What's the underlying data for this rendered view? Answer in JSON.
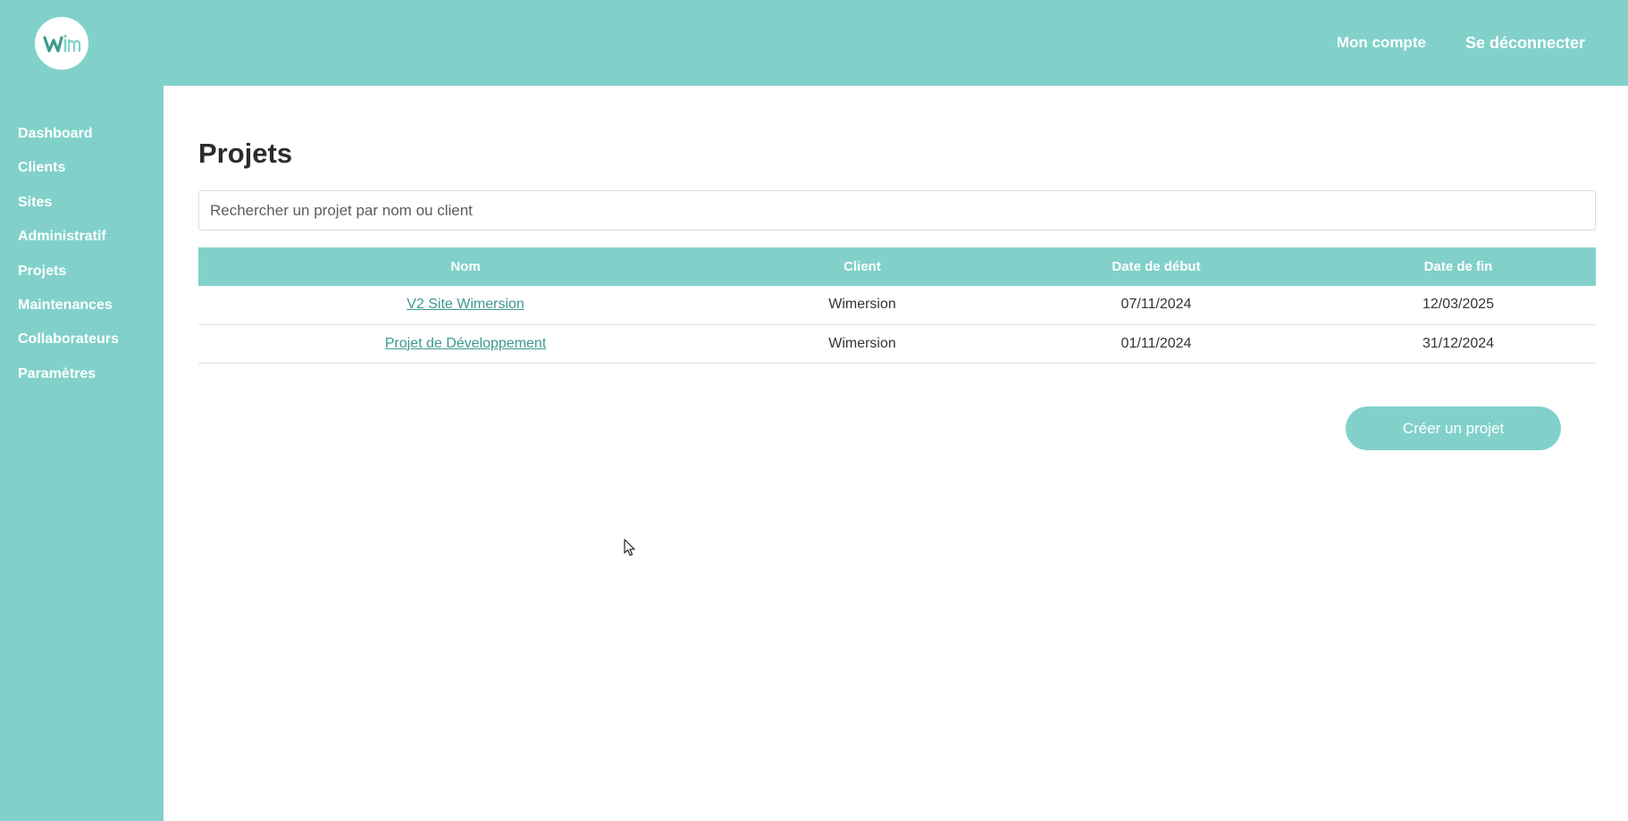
{
  "colors": {
    "accent": "#81d1ca",
    "link": "#3c9a91",
    "text": "#2b2b2b"
  },
  "header": {
    "logo_icon": "wim-logo-icon",
    "account_label": "Mon compte",
    "logout_label": "Se déconnecter"
  },
  "sidebar": {
    "items": [
      {
        "label": "Dashboard"
      },
      {
        "label": "Clients"
      },
      {
        "label": "Sites"
      },
      {
        "label": "Administratif"
      },
      {
        "label": "Projets"
      },
      {
        "label": "Maintenances"
      },
      {
        "label": "Collaborateurs"
      },
      {
        "label": "Paramètres"
      }
    ]
  },
  "main": {
    "title": "Projets",
    "search": {
      "value": "",
      "placeholder": "Rechercher un projet par nom ou client"
    },
    "table": {
      "headers": [
        "Nom",
        "Client",
        "Date de début",
        "Date de fin"
      ],
      "rows": [
        {
          "nom": "V2 Site Wimersion",
          "client": "Wimersion",
          "debut": "07/11/2024",
          "fin": "12/03/2025"
        },
        {
          "nom": "Projet de Développement",
          "client": "Wimersion",
          "debut": "01/11/2024",
          "fin": "31/12/2024"
        }
      ]
    },
    "create_button_label": "Créer un projet"
  },
  "cursor_icon": "mouse-pointer-icon"
}
